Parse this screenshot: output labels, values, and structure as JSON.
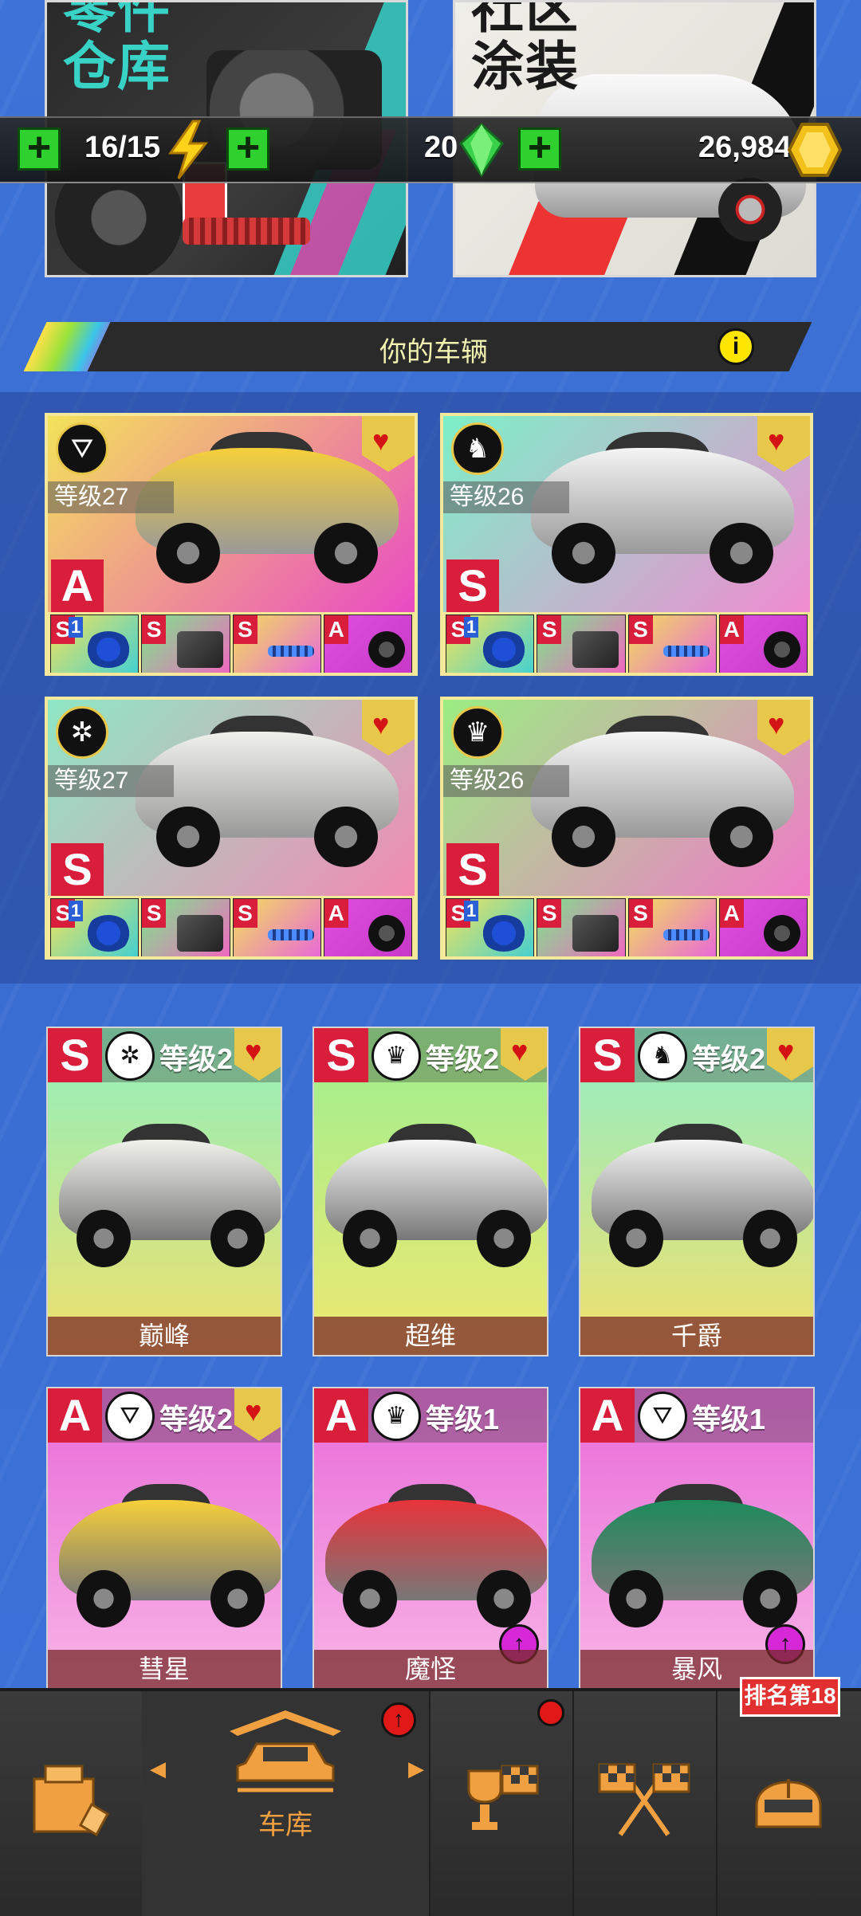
{
  "promos": {
    "left_title": "零件\n仓库",
    "right_title": "社区\n涂装"
  },
  "resources": {
    "energy": "16/15",
    "gems": "20",
    "coins": "26,984"
  },
  "section": {
    "title": "你的车辆",
    "info": "i"
  },
  "featured": [
    {
      "level": "等级27",
      "grade": "A",
      "class_icon": "road-icon",
      "bg": [
        "#f3e35a",
        "#e94ac4"
      ],
      "parts": [
        {
          "g": "S",
          "n": "1"
        },
        {
          "g": "S",
          "n": ""
        },
        {
          "g": "S",
          "n": ""
        },
        {
          "g": "A",
          "n": ""
        }
      ],
      "car_color": "#f6cf3a"
    },
    {
      "level": "等级26",
      "grade": "S",
      "class_icon": "horse-icon",
      "bg": [
        "#7cf0c8",
        "#f08bd0"
      ],
      "parts": [
        {
          "g": "S",
          "n": "1"
        },
        {
          "g": "S",
          "n": ""
        },
        {
          "g": "S",
          "n": ""
        },
        {
          "g": "A",
          "n": ""
        }
      ],
      "car_color": "#f4f4f4"
    },
    {
      "level": "等级27",
      "grade": "S",
      "class_icon": "wheel-icon",
      "bg": [
        "#8ee8c4",
        "#f28ab2"
      ],
      "parts": [
        {
          "g": "S",
          "n": "1"
        },
        {
          "g": "S",
          "n": ""
        },
        {
          "g": "S",
          "n": ""
        },
        {
          "g": "A",
          "n": ""
        }
      ],
      "car_color": "#f1f1ec"
    },
    {
      "level": "等级26",
      "grade": "S",
      "class_icon": "crown-icon",
      "bg": [
        "#9aee82",
        "#f07ac8"
      ],
      "parts": [
        {
          "g": "S",
          "n": "1"
        },
        {
          "g": "S",
          "n": ""
        },
        {
          "g": "S",
          "n": ""
        },
        {
          "g": "A",
          "n": ""
        }
      ],
      "car_color": "#f6f6f6"
    }
  ],
  "garage": [
    {
      "grade": "S",
      "class_icon": "wheel-icon",
      "level": "等级2",
      "name": "巅峰",
      "fav": true,
      "upgrade": false,
      "car_color": "#f1f1ec",
      "bg": [
        "#8ef0c0",
        "#f0e06a"
      ]
    },
    {
      "grade": "S",
      "class_icon": "crown-icon",
      "level": "等级2",
      "name": "超维",
      "fav": true,
      "upgrade": false,
      "car_color": "#f6f6f6",
      "bg": [
        "#9aef90",
        "#f0e870"
      ]
    },
    {
      "grade": "S",
      "class_icon": "horse-icon",
      "level": "等级2",
      "name": "千爵",
      "fav": true,
      "upgrade": false,
      "car_color": "#f4f4f4",
      "bg": [
        "#8eeec8",
        "#f2e06a"
      ]
    },
    {
      "grade": "A",
      "class_icon": "road-icon",
      "level": "等级2",
      "name": "彗星",
      "fav": true,
      "upgrade": false,
      "car_color": "#f6cf3a",
      "bg": [
        "#e86ad8",
        "#f8b4e6"
      ]
    },
    {
      "grade": "A",
      "class_icon": "crown-icon",
      "level": "等级1",
      "name": "魔怪",
      "fav": false,
      "upgrade": true,
      "car_color": "#e8333a",
      "bg": [
        "#e86ad8",
        "#f8b4e6"
      ]
    },
    {
      "grade": "A",
      "class_icon": "road-icon",
      "level": "等级1",
      "name": "暴风",
      "fav": false,
      "upgrade": true,
      "car_color": "#1f8a5c",
      "bg": [
        "#e86ad8",
        "#f8b4e6"
      ]
    }
  ],
  "nav": {
    "garage_label": "车库",
    "rank_label": "排名第18"
  },
  "colors": {
    "accent_orange": "#f0a040",
    "grade_red": "#d91e3b",
    "plus_green": "#2ed12e"
  }
}
